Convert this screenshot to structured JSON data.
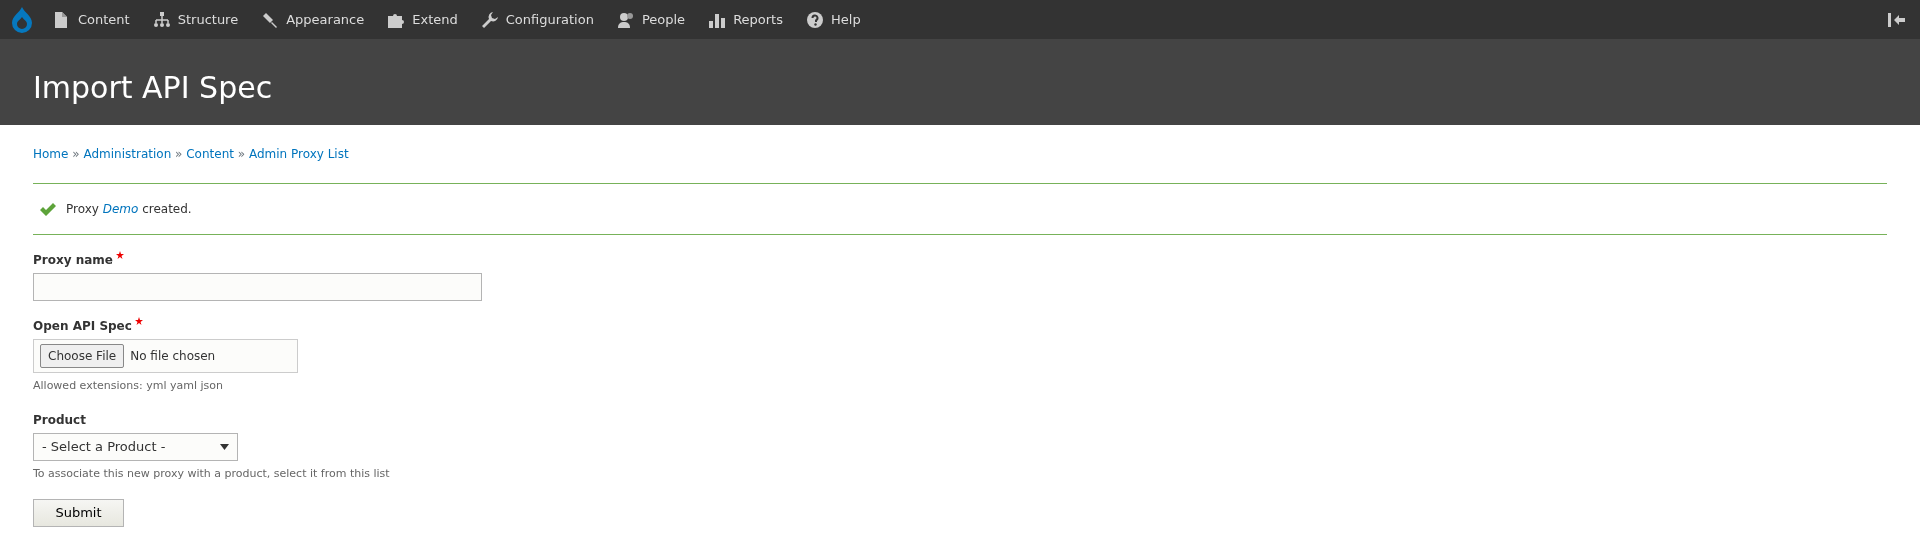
{
  "toolbar": {
    "items": [
      {
        "label": "Content"
      },
      {
        "label": "Structure"
      },
      {
        "label": "Appearance"
      },
      {
        "label": "Extend"
      },
      {
        "label": "Configuration"
      },
      {
        "label": "People"
      },
      {
        "label": "Reports"
      },
      {
        "label": "Help"
      }
    ]
  },
  "page_title": "Import API Spec",
  "breadcrumb": [
    "Home",
    "Administration",
    "Content",
    "Admin Proxy List"
  ],
  "breadcrumb_separator": "»",
  "message": {
    "before": "Proxy",
    "link": "Demo",
    "after": "created."
  },
  "form": {
    "fields": [
      {
        "kind": "text",
        "label": "Proxy name",
        "required": true
      },
      {
        "kind": "file",
        "label": "Open API Spec",
        "required": true,
        "button": "Choose File",
        "value": "No file chosen",
        "help": "Allowed extensions: yml yaml json"
      },
      {
        "kind": "select",
        "label": "Product",
        "required": false,
        "value": "- Select a Product -",
        "help": "To associate this new proxy with a product, select it from this list"
      }
    ],
    "submit": "Submit"
  }
}
